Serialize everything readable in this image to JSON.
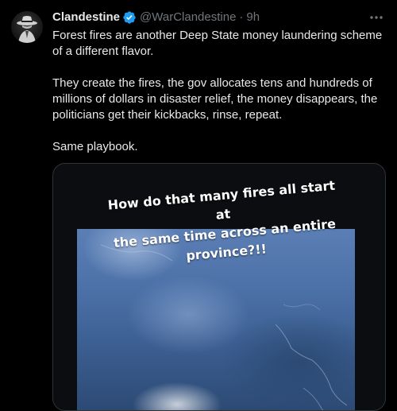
{
  "tweet": {
    "author": {
      "display_name": "Clandestine",
      "handle": "@WarClandestine",
      "verified": true
    },
    "separator": "·",
    "time": "9h",
    "body": [
      "Forest fires are another Deep State money laundering scheme of a different flavor.",
      "They create the fires, the gov allocates tens and hundreds of millions of dollars in disaster relief, the money disappears, the politicians get their kickbacks, rinse, repeat.",
      "Same playbook."
    ],
    "media": {
      "caption": "How do that many fires all start at\nthe same time across an entire\nprovince?!!"
    }
  },
  "colors": {
    "background": "#000000",
    "primary_text": "#e7e9ea",
    "secondary_text": "#71767b",
    "verified_badge": "#1d9bf0",
    "border": "#2f3336"
  },
  "icons": {
    "verified": "verified-badge-icon",
    "more": "more-horizontal-icon"
  }
}
